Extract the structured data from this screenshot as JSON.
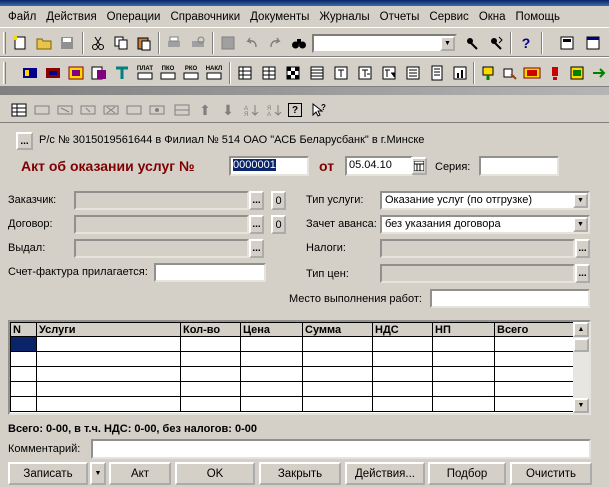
{
  "menu": [
    "Файл",
    "Действия",
    "Операции",
    "Справочники",
    "Документы",
    "Журналы",
    "Отчеты",
    "Сервис",
    "Окна",
    "Помощь"
  ],
  "toolbar1_icons": [
    "new-doc-icon",
    "open-folder-icon",
    "save-icon",
    "cut-icon",
    "copy-icon",
    "paste-icon",
    "print-icon",
    "print-preview-icon",
    "calendar-icon",
    "undo-icon",
    "redo-icon",
    "binoculars-icon"
  ],
  "toolbar1_right_icons": [
    "find-icon",
    "find-next-icon",
    "help-icon",
    "calculator-icon",
    "calendar-icon"
  ],
  "toolbar2_icons": [
    "ledger-icon",
    "register-icon",
    "cashbook-icon",
    "docs-icon",
    "tools-icon",
    "plat-icon",
    "pko-icon",
    "rko-icon",
    "nakl-icon",
    "grid1-icon",
    "grid2-icon",
    "checker-icon",
    "grid3-icon",
    "text-icon",
    "text2-icon",
    "text3-icon",
    "list-icon",
    "chart-icon",
    "tools2-icon",
    "tools3-icon",
    "rec-icon",
    "warning-icon",
    "report-icon",
    "exit-icon"
  ],
  "toolbar2_labels": {
    "plat": "ПЛАТ",
    "pko": "ПКО",
    "rko": "РКО",
    "nakl": "НАКЛ"
  },
  "bank_account": "Р/с № 3015019561644 в Филиал № 514 ОАО \"АСБ Беларусбанк\" в г.Минске",
  "doc": {
    "title": "Акт об оказании услуг №",
    "number": "0000001",
    "from_label": "от",
    "date": "05.04.10",
    "series_label": "Серия:",
    "series": ""
  },
  "left_fields": {
    "customer_label": "Заказчик:",
    "contract_label": "Договор:",
    "issued_label": "Выдал:",
    "invoice_label": "Счет-фактура прилагается:",
    "dots": "...",
    "o": "0"
  },
  "right_fields": {
    "service_type_label": "Тип услуги:",
    "service_type": "Оказание услуг (по отгрузке)",
    "advance_label": "Зачет аванса:",
    "advance": "без указания договора",
    "taxes_label": "Налоги:",
    "price_type_label": "Тип цен:",
    "work_place_label": "Место выполнения работ:"
  },
  "table": {
    "headers": [
      "N",
      "Услуги",
      "Кол-во",
      "Цена",
      "Сумма",
      "НДС",
      "НП",
      "Всего"
    ]
  },
  "summary": "Всего: 0-00, в т.ч. НДС: 0-00, без налогов: 0-00",
  "comment_label": "Комментарий:",
  "buttons": {
    "save": "Записать",
    "act": "Акт",
    "ok": "OK",
    "close": "Закрыть",
    "actions": "Действия...",
    "select": "Подбор",
    "clear": "Очистить"
  }
}
